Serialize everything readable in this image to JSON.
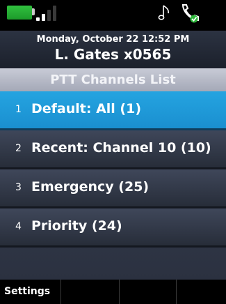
{
  "status_bar": {
    "battery_icon": "battery-icon",
    "battery_color": "#2fb83c",
    "signal_icon": "signal-strength-icon",
    "signal_bars_active": 2,
    "signal_bars_total": 4,
    "music_icon": "music-note-icon",
    "headset_icon": "headset-icon",
    "headset_check_color": "#2fb83c"
  },
  "header": {
    "datetime": "Monday, October 22 12:52 PM",
    "user": "L. Gates x0565"
  },
  "list": {
    "title": "PTT Channels List",
    "items": [
      {
        "number": "1",
        "label": "Default: All (1)",
        "selected": true
      },
      {
        "number": "2",
        "label": "Recent: Channel 10 (10)",
        "selected": false
      },
      {
        "number": "3",
        "label": "Emergency (25)",
        "selected": false
      },
      {
        "number": "4",
        "label": "Priority (24)",
        "selected": false
      }
    ]
  },
  "softkeys": {
    "settings": "Settings",
    "key2": "",
    "key3": "",
    "key4": ""
  },
  "colors": {
    "selected_row": "#1f9ad8",
    "row": "#343b4c",
    "title_bar": "#b6b9c6"
  }
}
